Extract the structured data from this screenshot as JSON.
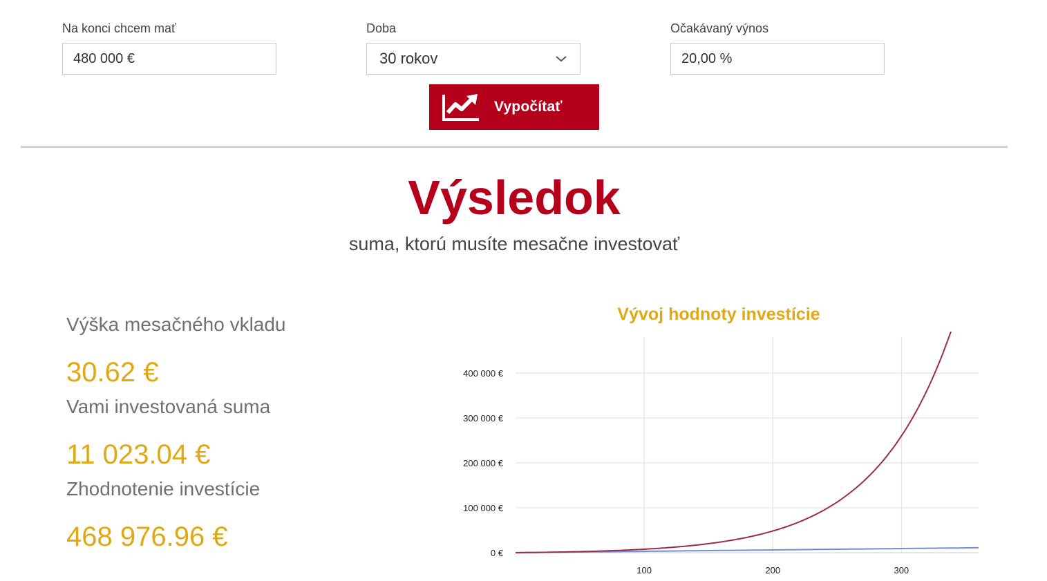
{
  "form": {
    "target_label": "Na konci chcem mať",
    "target_value": "480 000 €",
    "period_label": "Doba",
    "period_value": "30 rokov",
    "yield_label": "Očakávaný výnos",
    "yield_value": "20,00 %",
    "calc_button_label": "Vypočítať",
    "calc_button_icon": "chart-trend-up-icon",
    "period_icon": "chevron-down-icon"
  },
  "result": {
    "title": "Výsledok",
    "subtitle": "suma, ktorú musíte mesačne investovať",
    "monthly_label": "Výška mesačného vkladu",
    "monthly_value": "30.62 €",
    "invested_label": "Vami investovaná suma",
    "invested_value": "11 023.04 €",
    "gain_label": "Zhodnotenie investície",
    "gain_value": "468 976.96 €"
  },
  "colors": {
    "brand_red": "#b5001b",
    "accent_gold": "#e0a814",
    "value_series": "#9b2a4c",
    "invested_series": "#6d8fd6"
  },
  "chart_data": {
    "type": "line",
    "title": "Vývoj hodnoty investície",
    "xlabel": "",
    "ylabel": "",
    "xlim": [
      1,
      360
    ],
    "ylim": [
      0,
      480000
    ],
    "x_ticks": [
      100,
      200,
      300
    ],
    "x_tick_labels": [
      "100",
      "200",
      "300"
    ],
    "y_ticks": [
      0,
      100000,
      200000,
      300000,
      400000
    ],
    "y_tick_labels": [
      "0 €",
      "100 000 €",
      "200 000 €",
      "300 000 €",
      "400 000 €"
    ],
    "grid": true,
    "legend": "none",
    "monthly_deposit": 30.62,
    "annual_rate": 0.2,
    "months": 360,
    "series": [
      {
        "x": [
          0,
          60,
          120,
          180,
          240,
          300,
          360
        ],
        "values": [
          0,
          2980,
          11350,
          34800,
          100400,
          184300,
          480000
        ],
        "color": "#9b2a4c"
      },
      {
        "x": [
          0,
          60,
          120,
          180,
          240,
          300,
          360
        ],
        "values": [
          0,
          1837,
          3674,
          5512,
          7349,
          9186,
          11023
        ],
        "color": "#6d8fd6"
      }
    ]
  }
}
